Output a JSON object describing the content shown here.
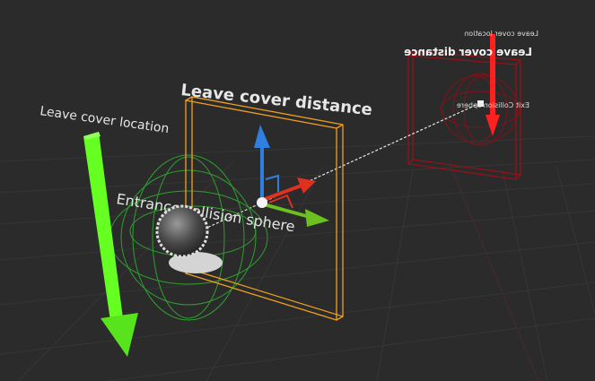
{
  "labels": {
    "leave_cover_location": "Leave cover location",
    "leave_cover_distance": "Leave cover distance",
    "entrance_collision_sphere": "Entrance collision sphere",
    "mirror_leave_cover_location": "Leave cover location",
    "mirror_leave_cover_distance": "Leave cover distance",
    "mirror_exit_collision_sphere": "Exit Collision sphere"
  },
  "colors": {
    "background": "#2b2b2b",
    "grid": "#3a3a3a",
    "location_arrow": "#66ff22",
    "distance_frame": "#f0a020",
    "collision_sphere": "#2f9e2f",
    "gizmo_x": "#e03020",
    "gizmo_y": "#6cc020",
    "gizmo_z": "#2f7fe0",
    "mirror": "#b0101a",
    "mirror_arrow": "#ff2020"
  },
  "icons": [
    "translate-gizmo-icon",
    "sphere-actor-icon"
  ]
}
